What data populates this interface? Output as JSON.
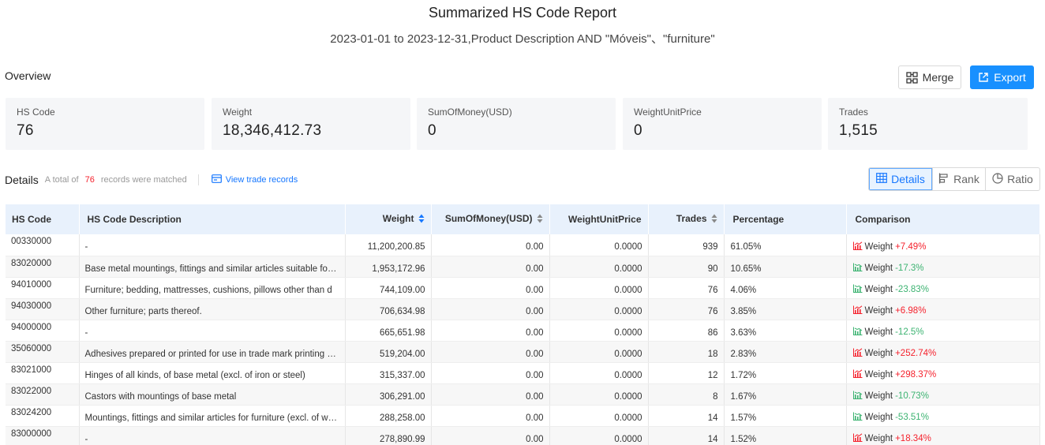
{
  "header": {
    "title": "Summarized HS Code Report",
    "subtitle": "2023-01-01 to 2023-12-31,Product Description AND \"Móveis\"、\"furniture\""
  },
  "overview": {
    "label": "Overview",
    "merge_label": "Merge",
    "export_label": "Export",
    "cards": [
      {
        "label": "HS Code",
        "value": "76"
      },
      {
        "label": "Weight",
        "value": "18,346,412.73"
      },
      {
        "label": "SumOfMoney(USD)",
        "value": "0"
      },
      {
        "label": "WeightUnitPrice",
        "value": "0"
      },
      {
        "label": "Trades",
        "value": "1,515"
      }
    ]
  },
  "details": {
    "label": "Details",
    "count_prefix": "A total of",
    "count": "76",
    "count_suffix": "records were matched",
    "view_link": "View trade records",
    "tabs": [
      {
        "label": "Details",
        "icon": "table-icon",
        "active": true
      },
      {
        "label": "Rank",
        "icon": "bar-rank-icon",
        "active": false
      },
      {
        "label": "Ratio",
        "icon": "pie-icon",
        "active": false
      }
    ]
  },
  "table": {
    "columns": [
      "HS Code",
      "HS Code Description",
      "Weight",
      "SumOfMoney(USD)",
      "WeightUnitPrice",
      "Trades",
      "Percentage",
      "Comparison"
    ],
    "rows": [
      {
        "code": "00330000",
        "desc": "-",
        "weight": "11,200,200.85",
        "money": "0.00",
        "unit": "0.0000",
        "trades": "939",
        "pct": "61.05%",
        "cmp_label": "Weight",
        "cmp_value": "+7.49%",
        "trend": "up"
      },
      {
        "code": "83020000",
        "desc": "Base metal mountings, fittings and similar articles suitable for furniture, doors, staircases, windows",
        "weight": "1,953,172.96",
        "money": "0.00",
        "unit": "0.0000",
        "trades": "90",
        "pct": "10.65%",
        "cmp_label": "Weight",
        "cmp_value": "-17.3%",
        "trend": "down"
      },
      {
        "code": "94010000",
        "desc": "Furniture; bedding, mattresses, cushions, pillows other than d",
        "weight": "744,109.00",
        "money": "0.00",
        "unit": "0.0000",
        "trades": "76",
        "pct": "4.06%",
        "cmp_label": "Weight",
        "cmp_value": "-23.83%",
        "trend": "down"
      },
      {
        "code": "94030000",
        "desc": "Other furniture; parts thereof.",
        "weight": "706,634.98",
        "money": "0.00",
        "unit": "0.0000",
        "trades": "76",
        "pct": "3.85%",
        "cmp_label": "Weight",
        "cmp_value": "+6.98%",
        "trend": "up"
      },
      {
        "code": "94000000",
        "desc": "-",
        "weight": "665,651.98",
        "money": "0.00",
        "unit": "0.0000",
        "trades": "86",
        "pct": "3.63%",
        "cmp_label": "Weight",
        "cmp_value": "-12.5%",
        "trend": "down"
      },
      {
        "code": "35060000",
        "desc": "Adhesives prepared or printed for use in trade mark printing or stamping",
        "weight": "519,204.00",
        "money": "0.00",
        "unit": "0.0000",
        "trades": "18",
        "pct": "2.83%",
        "cmp_label": "Weight",
        "cmp_value": "+252.74%",
        "trend": "up"
      },
      {
        "code": "83021000",
        "desc": "Hinges of all kinds, of base metal (excl. of iron or steel)",
        "weight": "315,337.00",
        "money": "0.00",
        "unit": "0.0000",
        "trades": "12",
        "pct": "1.72%",
        "cmp_label": "Weight",
        "cmp_value": "+298.37%",
        "trend": "up"
      },
      {
        "code": "83022000",
        "desc": "Castors with mountings of base metal",
        "weight": "306,291.00",
        "money": "0.00",
        "unit": "0.0000",
        "trades": "8",
        "pct": "1.67%",
        "cmp_label": "Weight",
        "cmp_value": "-10.73%",
        "trend": "down"
      },
      {
        "code": "83024200",
        "desc": "Mountings, fittings and similar articles for furniture (excl. of wood)",
        "weight": "288,258.00",
        "money": "0.00",
        "unit": "0.0000",
        "trades": "14",
        "pct": "1.57%",
        "cmp_label": "Weight",
        "cmp_value": "-53.51%",
        "trend": "down"
      },
      {
        "code": "83000000",
        "desc": "-",
        "weight": "278,890.99",
        "money": "0.00",
        "unit": "0.0000",
        "trades": "14",
        "pct": "1.52%",
        "cmp_label": "Weight",
        "cmp_value": "+18.34%",
        "trend": "up"
      }
    ]
  },
  "colors": {
    "primary": "#1890ff",
    "up": "#f5222d",
    "down": "#3cb371",
    "header_bg": "#e8f1fc",
    "card_bg": "#f5f6f8"
  }
}
